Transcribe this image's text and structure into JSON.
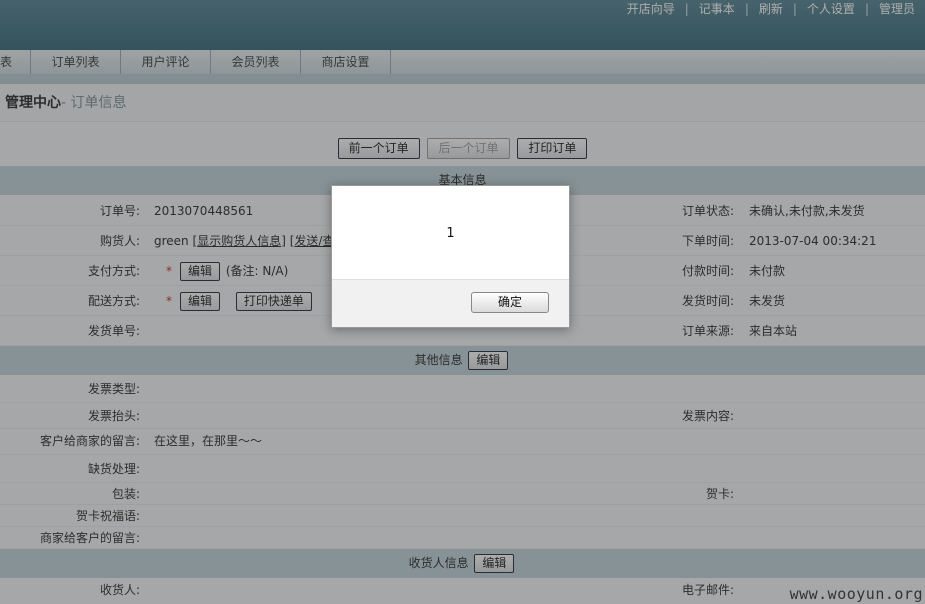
{
  "header": {
    "links": [
      "开店向导",
      "记事本",
      "刷新",
      "个人设置",
      "管理员"
    ],
    "separator": "|"
  },
  "nav": {
    "tabs": [
      "表",
      "订单列表",
      "用户评论",
      "会员列表",
      "商店设置"
    ]
  },
  "breadcrumb": {
    "main": "管理中心",
    "sub": "- 订单信息"
  },
  "actions": {
    "prev": "前一个订单",
    "next": "后一个订单",
    "print": "打印订单"
  },
  "basic": {
    "title": "基本信息",
    "order_no_label": "订单号:",
    "order_no": "2013070448561",
    "buyer_label": "购货人:",
    "buyer_name": "green",
    "bracket_open": "[",
    "bracket_close": "]",
    "show_buyer_link": "显示购货人信息",
    "send_link": "发送/查看留言",
    "pay_label": "支付方式:",
    "edit": "编辑",
    "pay_note": "(备注: N/A)",
    "ship_label": "配送方式:",
    "print_express": "打印快递单",
    "ship_no_label": "发货单号:",
    "status_label": "订单状态:",
    "status": "未确认,未付款,未发货",
    "order_time_label": "下单时间:",
    "order_time": "2013-07-04 00:34:21",
    "pay_time_label": "付款时间:",
    "pay_time": "未付款",
    "ship_time_label": "发货时间:",
    "ship_time": "未发货",
    "source_label": "订单来源:",
    "source": "来自本站"
  },
  "other": {
    "title": "其他信息",
    "edit": "编辑",
    "invoice_type_label": "发票类型:",
    "invoice_title_label": "发票抬头:",
    "invoice_content_label": "发票内容:",
    "customer_msg_label": "客户给商家的留言:",
    "customer_msg": "在这里，在那里～～",
    "stockout_label": "缺货处理:",
    "pack_label": "包装:",
    "card_label": "贺卡:",
    "card_msg_label": "贺卡祝福语:",
    "merchant_msg_label": "商家给客户的留言:"
  },
  "consignee": {
    "title": "收货人信息",
    "edit": "编辑",
    "name_label": "收货人:",
    "email_label": "电子邮件:"
  },
  "dialog": {
    "message": "1",
    "ok": "确定"
  },
  "watermark": "www.wooyun.org"
}
